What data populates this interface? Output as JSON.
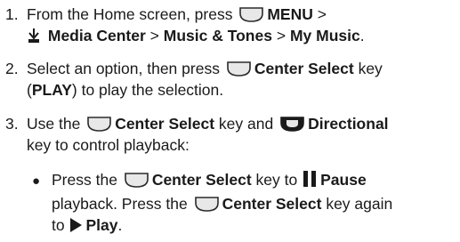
{
  "step1": {
    "number": "1.",
    "t1": "From the Home screen, press",
    "menu": "MENU",
    "sep1": ">",
    "media": "Media Center",
    "sep2": ">",
    "music_tones": "Music & Tones",
    "sep3": ">",
    "my_music": "My Music",
    "end": "."
  },
  "step2": {
    "number": "2.",
    "t1": "Select an option, then press",
    "center": "Center Select",
    "t2": "key",
    "paren_open": "(",
    "play": "PLAY",
    "t3": ") to play the selection."
  },
  "step3": {
    "number": "3.",
    "t1": "Use the",
    "center": "Center Select",
    "t2": "key and",
    "directional": "Directional",
    "t3": "key to control playback:"
  },
  "bullet": {
    "t1": "Press the",
    "center": "Center Select",
    "t2": "key to",
    "pause": "Pause",
    "t3": "playback. Press the",
    "center2": "Center Select",
    "t4": "key again",
    "t5": "to",
    "play": "Play",
    "end": "."
  },
  "colors": {
    "text": "#1a1a1a",
    "key_fill": "#e8e8e8",
    "key_stroke": "#2a2a2a",
    "dir_key_fill": "#1a1a1a"
  }
}
